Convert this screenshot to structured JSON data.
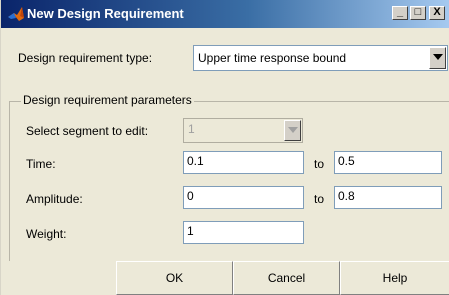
{
  "window": {
    "title": "New Design Requirement",
    "minimize_label": "_",
    "maximize_label": "□",
    "close_label": "X",
    "app_icon": "matlab-logo-icon"
  },
  "requirement_type": {
    "label": "Design requirement type:",
    "value": "Upper time response bound"
  },
  "parameters": {
    "group_title": "Design requirement parameters",
    "segment": {
      "label": "Select segment to edit:",
      "value": "1",
      "disabled": true
    },
    "time": {
      "label": "Time:",
      "from": "0.1",
      "to_label": "to",
      "to": "0.5"
    },
    "amplitude": {
      "label": "Amplitude:",
      "from": "0",
      "to_label": "to",
      "to": "0.8"
    },
    "weight": {
      "label": "Weight:",
      "value": "1"
    }
  },
  "buttons": {
    "ok": "OK",
    "cancel": "Cancel",
    "help": "Help"
  },
  "colors": {
    "titlebar_start": "#0a246a",
    "titlebar_end": "#a6caf0",
    "dialog_bg": "#ece9d8",
    "field_border": "#7f9db9"
  }
}
